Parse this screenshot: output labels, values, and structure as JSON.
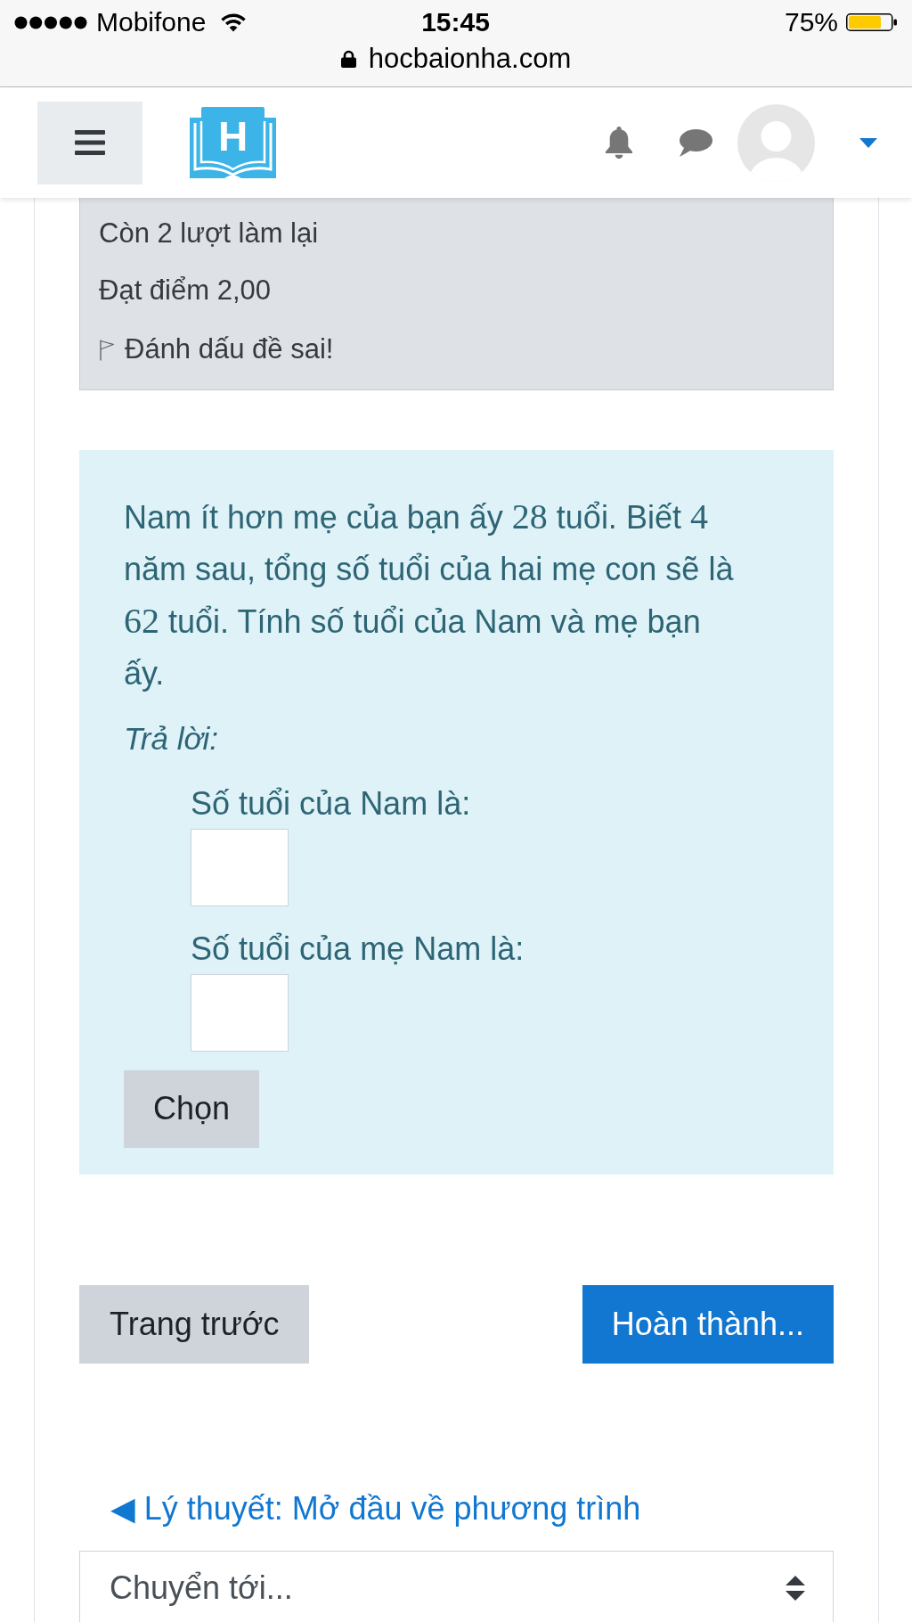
{
  "status_bar": {
    "carrier": "Mobifone",
    "time": "15:45",
    "battery": "75%",
    "url": "hocbaionha.com"
  },
  "navbar": {
    "logo_letter": "H"
  },
  "attempt_info": {
    "lines": [
      "Còn 2 lượt làm lại",
      "Đạt điểm 2,00"
    ],
    "flag_label": "Đánh dấu đề sai!"
  },
  "question": {
    "text_parts": [
      {
        "kind": "text",
        "text": "Nam ít hơn mẹ của bạn ấy "
      },
      {
        "kind": "math",
        "text": "28"
      },
      {
        "kind": "text",
        "text": " tuổi. Biết "
      },
      {
        "kind": "math",
        "text": "4"
      },
      {
        "kind": "text",
        "text": " năm sau, tổng số tuổi của hai mẹ con sẽ là "
      },
      {
        "kind": "math",
        "text": "62"
      },
      {
        "kind": "text",
        "text": " tuổi. Tính số tuổi của Nam và mẹ bạn ấy."
      }
    ],
    "prompt": "Trả lời:",
    "answers": [
      {
        "label": "Số tuổi của Nam là:"
      },
      {
        "label": "Số tuổi của mẹ Nam là:"
      }
    ],
    "submit_button": "Chọn"
  },
  "page_nav": {
    "previous_button": "Trang trước",
    "finish_button": "Hoàn thành..."
  },
  "activity_nav": {
    "previous_link": "◀ Lý thuyết: Mở đầu về phương trình",
    "jump_select": {
      "value": "Chuyển tới..."
    }
  }
}
